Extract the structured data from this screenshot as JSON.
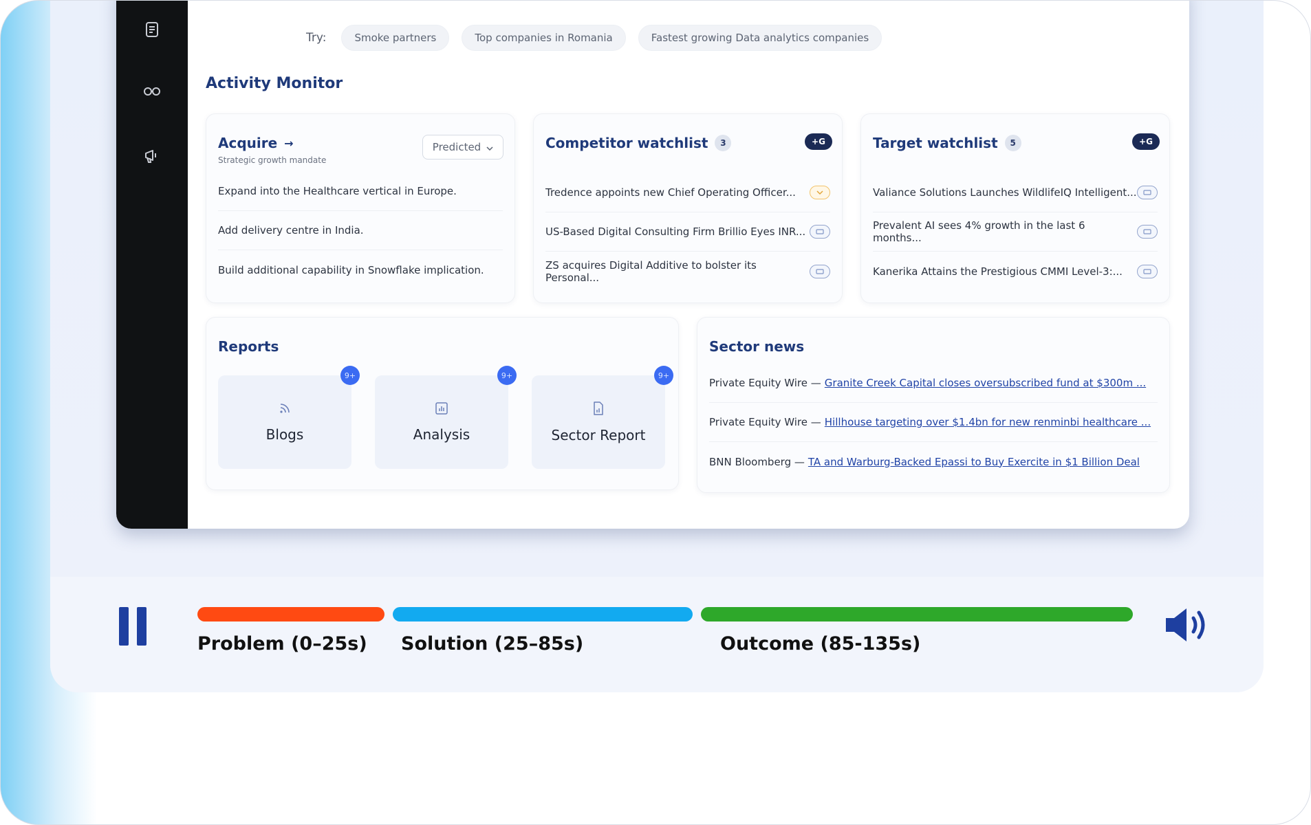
{
  "try": {
    "label": "Try:",
    "chips": [
      "Smoke partners",
      "Top companies in Romania",
      "Fastest growing Data analytics companies"
    ]
  },
  "activity": {
    "title": "Activity Monitor"
  },
  "acquire": {
    "title": "Acquire",
    "subtitle": "Strategic growth mandate",
    "dropdown": "Predicted",
    "items": [
      "Expand into the Healthcare vertical in Europe.",
      "Add delivery centre in India.",
      "Build additional capability in Snowflake implication."
    ]
  },
  "competitor": {
    "title": "Competitor watchlist",
    "count": "3",
    "badge": "+G",
    "items": [
      "Tredence appoints new Chief Operating Officer...",
      "US-Based Digital Consulting Firm Brillio Eyes INR...",
      "ZS acquires Digital Additive to bolster its Personal..."
    ]
  },
  "target": {
    "title": "Target watchlist",
    "count": "5",
    "badge": "+G",
    "items": [
      "Valiance Solutions Launches WildlifeIQ Intelligent...",
      "Prevalent AI sees 4% growth in the last 6 months...",
      "Kanerika Attains the Prestigious CMMI Level-3:..."
    ]
  },
  "reports": {
    "title": "Reports",
    "tiles": [
      {
        "label": "Blogs",
        "badge": "9+"
      },
      {
        "label": "Analysis",
        "badge": "9+"
      },
      {
        "label": "Sector Report",
        "badge": "9+"
      }
    ]
  },
  "sector_news": {
    "title": "Sector news",
    "items": [
      {
        "source": "Private Equity Wire —",
        "headline": "Granite Creek Capital closes oversubscribed fund at $300m ..."
      },
      {
        "source": "Private Equity Wire —",
        "headline": "Hillhouse targeting over $1.4bn for new renminbi healthcare ..."
      },
      {
        "source": "BNN Bloomberg —",
        "headline": "TA and Warburg-Backed Epassi to Buy Exercite in $1 Billion Deal"
      }
    ]
  },
  "player": {
    "segments": [
      {
        "label": "Problem (0–25s)",
        "color": "#ff4a12"
      },
      {
        "label": "Solution (25–85s)",
        "color": "#12aaf0"
      },
      {
        "label": "Outcome (85-135s)",
        "color": "#2ea82a"
      }
    ]
  }
}
